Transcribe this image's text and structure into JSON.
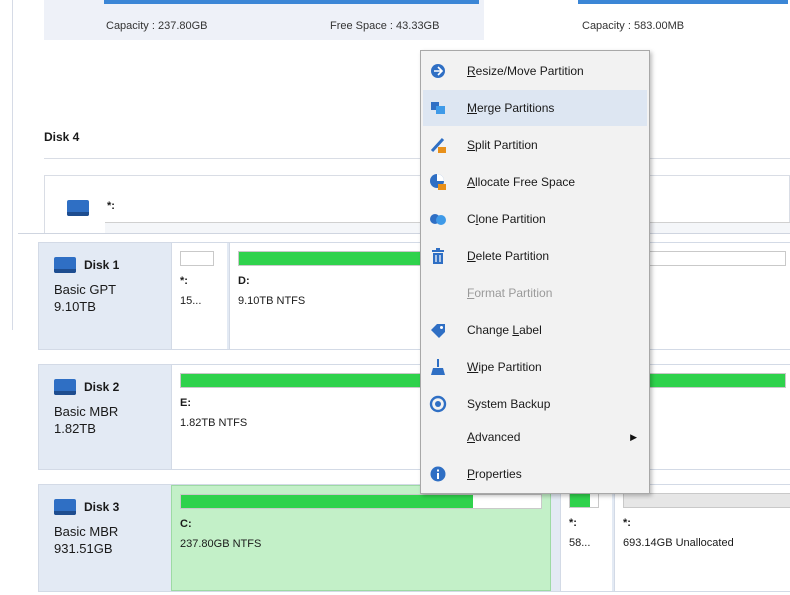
{
  "upper": {
    "left_capacity": "Capacity : 237.80GB",
    "left_free": "Free Space : 43.33GB",
    "right_capacity": "Capacity : 583.00MB"
  },
  "disk4": {
    "label": "Disk 4",
    "partition_label": "*:"
  },
  "disks": [
    {
      "name": "Disk 1",
      "type": "Basic GPT",
      "size": "9.10TB",
      "partitions": [
        {
          "label": "*:",
          "info": "15..."
        },
        {
          "label": "D:",
          "info": "9.10TB NTFS"
        }
      ]
    },
    {
      "name": "Disk 2",
      "type": "Basic MBR",
      "size": "1.82TB",
      "partitions": [
        {
          "label": "E:",
          "info": "1.82TB NTFS"
        }
      ]
    },
    {
      "name": "Disk 3",
      "type": "Basic MBR",
      "size": "931.51GB",
      "partitions": [
        {
          "label": "C:",
          "info": "237.80GB NTFS"
        },
        {
          "label": "*:",
          "info": "58..."
        },
        {
          "label": "*:",
          "info": "693.14GB Unallocated"
        }
      ]
    }
  ],
  "context_menu": {
    "items": [
      {
        "pre": "",
        "ul": "R",
        "post": "esize/Move Partition",
        "icon": "resize-move-icon"
      },
      {
        "pre": "",
        "ul": "M",
        "post": "erge Partitions",
        "icon": "merge-icon"
      },
      {
        "pre": "",
        "ul": "S",
        "post": "plit Partition",
        "icon": "split-icon"
      },
      {
        "pre": "",
        "ul": "A",
        "post": "llocate Free Space",
        "icon": "allocate-icon"
      },
      {
        "pre": "C",
        "ul": "l",
        "post": "one Partition",
        "icon": "clone-icon"
      },
      {
        "pre": "",
        "ul": "D",
        "post": "elete Partition",
        "icon": "delete-icon"
      },
      {
        "pre": "",
        "ul": "F",
        "post": "ormat Partition",
        "icon": "format-icon"
      },
      {
        "pre": "Change ",
        "ul": "L",
        "post": "abel",
        "icon": "label-icon"
      },
      {
        "pre": "",
        "ul": "W",
        "post": "ipe Partition",
        "icon": "wipe-icon"
      },
      {
        "pre": "System Backup",
        "ul": "",
        "post": "",
        "icon": "backup-icon"
      },
      {
        "pre": "",
        "ul": "A",
        "post": "dvanced",
        "icon": ""
      },
      {
        "pre": "",
        "ul": "P",
        "post": "roperties",
        "icon": "info-icon"
      }
    ],
    "hovered_item": "Merge Partitions",
    "disabled_item": "Format Partition"
  },
  "colors": {
    "used_space": "#2fd24c",
    "selected_partition": "#c3f0c8",
    "disk_panel": "#e3eaf4",
    "menu_hover": "#dde6f2",
    "accent_blue": "#2f6fc4"
  }
}
